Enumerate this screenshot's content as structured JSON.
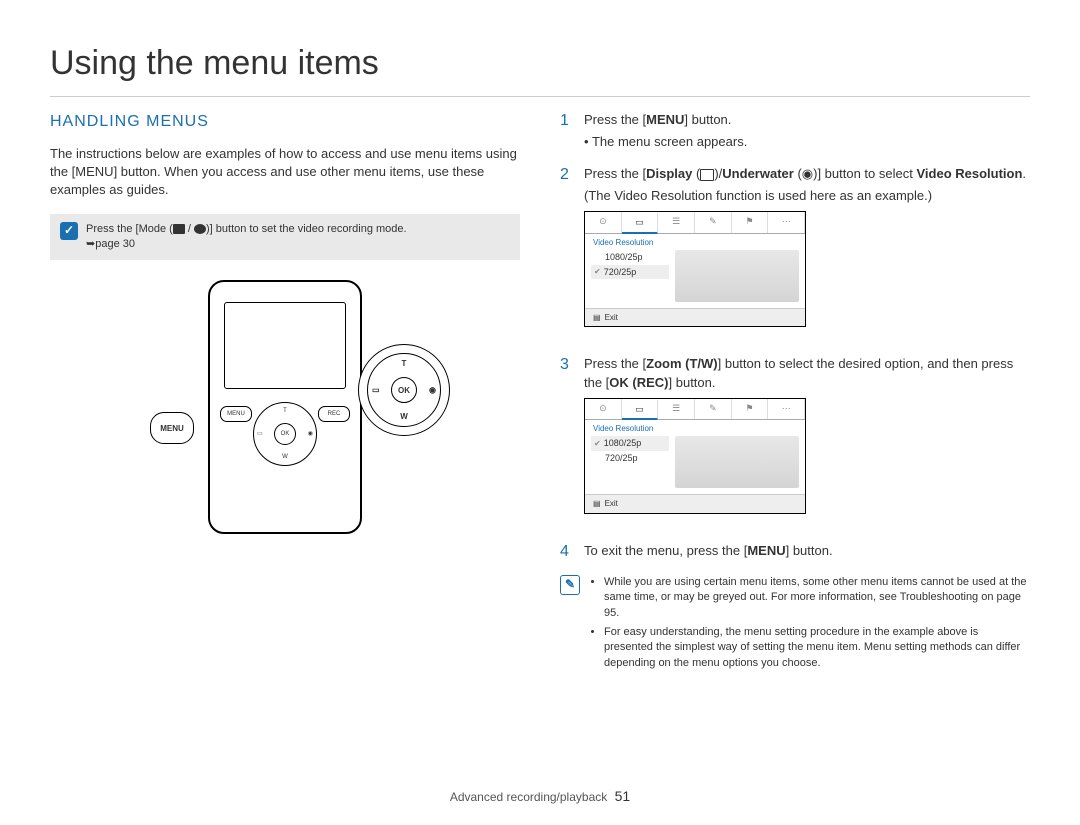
{
  "page_title": "Using the menu items",
  "section_heading": "HANDLING MENUS",
  "intro_paragraph": "The instructions below are examples of how to access and use menu items using the [MENU] button. When you access and use other menu items, use these examples as guides.",
  "note_box": {
    "line1_prefix": "Press the [Mode (",
    "line1_suffix": ")] button to set the video recording mode.",
    "line2": "➥page 30"
  },
  "device": {
    "menu_callout": "MENU",
    "ok_label": "OK",
    "t_label": "T",
    "w_label": "W",
    "btn_menu": "MENU",
    "btn_rec": "REC"
  },
  "steps": [
    {
      "num": "1",
      "text_parts": [
        "Press the [",
        "MENU",
        "] button."
      ],
      "sub_bullet": "The menu screen appears."
    },
    {
      "num": "2",
      "text_parts_a": [
        "Press the [",
        "Display",
        " ("
      ],
      "text_parts_b": [
        ")/",
        "Underwater",
        " ("
      ],
      "text_parts_c": [
        ")] button to select "
      ],
      "bold_tail": "Video Resolution",
      "tail_period": ".",
      "subtext": "(The Video Resolution function is used here as an example.)"
    },
    {
      "num": "3",
      "text_parts": [
        "Press the [",
        "Zoom (T/W)",
        "] button to select the desired option, and then press the [",
        "OK (REC)",
        "] button."
      ]
    },
    {
      "num": "4",
      "text_parts": [
        "To exit the menu, press the [",
        "MENU",
        "] button."
      ]
    }
  ],
  "lcd": {
    "title": "Video Resolution",
    "opt1": "1080/25p",
    "opt2": "720/25p",
    "exit": "Exit"
  },
  "info_bullets": [
    "While you are using certain menu items, some other menu items cannot be used at the same time, or may be greyed out. For more information, see Troubleshooting on page 95.",
    "For easy understanding, the menu setting procedure in the example above is presented the simplest way of setting the menu item. Menu setting methods can differ depending on the menu options you choose."
  ],
  "footer_chapter": "Advanced recording/playback",
  "footer_page": "51"
}
